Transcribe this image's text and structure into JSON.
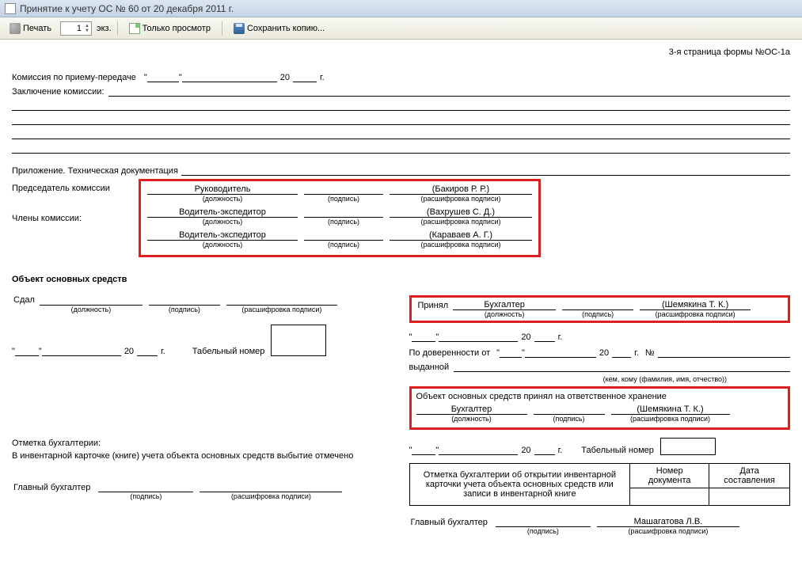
{
  "window": {
    "title": "Принятие к учету ОС № 60 от 20 декабря 2011 г."
  },
  "toolbar": {
    "print": "Печать",
    "copies_value": "1",
    "copies_suffix": "экз.",
    "preview": "Только просмотр",
    "save_copy": "Сохранить копию..."
  },
  "form": {
    "page_label": "3-я страница формы №ОС-1а",
    "commission_date_label": "Комиссия по приему-передаче",
    "year_g": "г.",
    "year_20": "20",
    "conclusion_label": "Заключение комиссии:",
    "attachment_label": "Приложение. Техническая документация",
    "chairman_label": "Председатель комиссии",
    "members_label": "Члены комиссии:",
    "col_position": "(должность)",
    "col_signature": "(подпись)",
    "col_decrypt": "(расшифровка подписи)",
    "chairman": {
      "position": "Руководитель",
      "name": "(Бакиров Р. Р.)"
    },
    "members": [
      {
        "position": "Водитель-экспедитор",
        "name": "(Вахрушев С. Д.)"
      },
      {
        "position": "Водитель-экспедитор",
        "name": "(Караваев А. Г.)"
      }
    ],
    "object_title": "Объект основных средств",
    "gave_label": "Сдал",
    "accepted_label": "Принял",
    "accepted": {
      "position": "Бухгалтер",
      "name": "(Шемякина Т. К.)"
    },
    "tab_number_label": "Табельный номер",
    "by_attorney_label": "По доверенности от",
    "num_sign": "№",
    "issued_label": "выданной",
    "issued_caption": "(кем, кому (фамилия, имя, отчество))",
    "storage_title": "Объект основных средств принял на ответственное хранение",
    "storage": {
      "position": "Бухгалтер",
      "name": "(Шемякина Т. К.)"
    },
    "acc_mark_left_1": "Отметка бухгалтерии:",
    "acc_mark_left_2": "В инвентарной карточке (книге) учета объекта основных средств выбытие отмечено",
    "acc_mark_right": "Отметка бухгалтерии об открытии инвентарной карточки учета объекта основных средств или записи в инвентарной книге",
    "doc_num_hdr": "Номер документа",
    "doc_date_hdr": "Дата составления",
    "chief_acc": "Главный бухгалтер",
    "chief_acc_name": "Машагатова  Л.В."
  }
}
